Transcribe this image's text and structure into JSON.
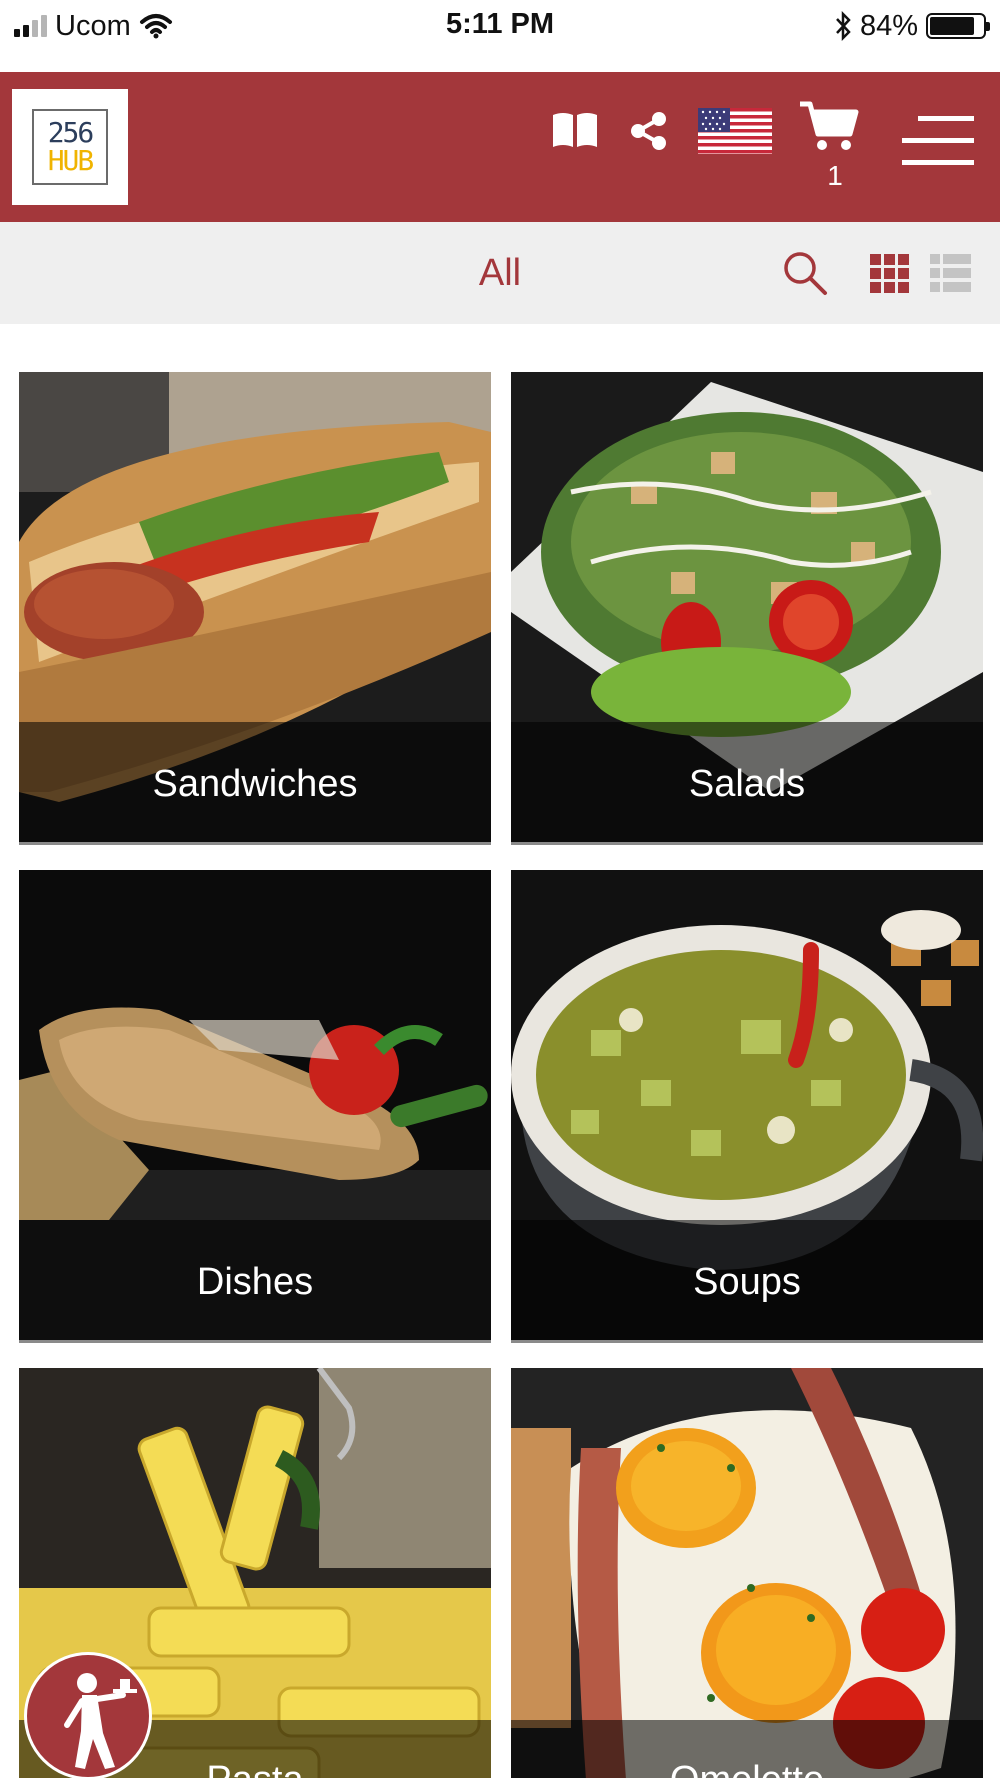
{
  "status_bar": {
    "carrier": "Ucom",
    "time": "5:11 PM",
    "battery_percent": "84%",
    "battery_level": 0.84,
    "icons": [
      "signal-icon",
      "wifi-icon",
      "bluetooth-icon",
      "battery-icon"
    ]
  },
  "header": {
    "logo": {
      "top": "256",
      "bottom": "HUB"
    },
    "icons": [
      "book-icon",
      "share-icon",
      "us-flag-icon",
      "cart-icon",
      "hamburger-menu-icon"
    ],
    "cart_count": "1",
    "brand_color": "#a3373b"
  },
  "filter_bar": {
    "label": "All",
    "icons": [
      "search-icon",
      "grid-view-icon",
      "list-view-icon"
    ],
    "active_view": "grid"
  },
  "categories": [
    {
      "name": "Sandwiches"
    },
    {
      "name": "Salads"
    },
    {
      "name": "Dishes"
    },
    {
      "name": "Soups"
    },
    {
      "name": "Pasta"
    },
    {
      "name": "Omelette"
    }
  ],
  "floating_button": {
    "icon": "waiter-icon"
  }
}
